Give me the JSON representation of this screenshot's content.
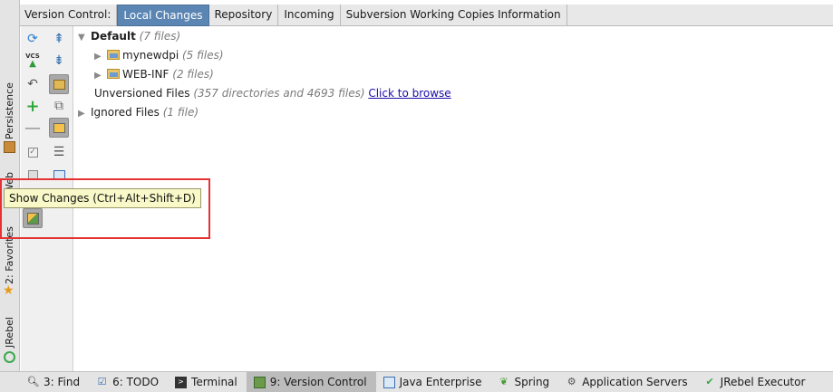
{
  "tabbar": {
    "label": "Version Control:",
    "tabs": [
      {
        "label": "Local Changes",
        "active": true
      },
      {
        "label": "Repository",
        "active": false
      },
      {
        "label": "Incoming",
        "active": false
      },
      {
        "label": "Subversion Working Copies Information",
        "active": false
      }
    ]
  },
  "left_strip": {
    "items": [
      "Persistence",
      "Web",
      "2: Favorites",
      "JRebel"
    ]
  },
  "toolbar": {
    "vcs_label": "VCS"
  },
  "tree": {
    "default": {
      "label": "Default",
      "count": "(7 files)"
    },
    "children": [
      {
        "label": "mynewdpi",
        "count": "(5 files)"
      },
      {
        "label": "WEB-INF",
        "count": "(2 files)"
      }
    ],
    "unversioned": {
      "label": "Unversioned Files",
      "count": "(357 directories and 4693 files)",
      "link": "Click to browse"
    },
    "ignored": {
      "label": "Ignored Files",
      "count": "(1 file)"
    }
  },
  "tooltip": {
    "text": "Show Changes (Ctrl+Alt+Shift+D)"
  },
  "statusbar": {
    "items": [
      {
        "label": "3: Find",
        "icon": "search-icon"
      },
      {
        "label": "6: TODO",
        "icon": "todo-icon"
      },
      {
        "label": "Terminal",
        "icon": "terminal-icon"
      },
      {
        "label": "9: Version Control",
        "icon": "version-control-icon",
        "active": true
      },
      {
        "label": "Java Enterprise",
        "icon": "java-enterprise-icon"
      },
      {
        "label": "Spring",
        "icon": "spring-icon"
      },
      {
        "label": "Application Servers",
        "icon": "application-servers-icon"
      },
      {
        "label": "JRebel Executor",
        "icon": "jrebel-executor-icon"
      }
    ]
  },
  "colors": {
    "active_tab": "#5b86b3",
    "tooltip_bg": "#f8f8c8",
    "highlight": "#e53333",
    "link": "#1a0dab"
  }
}
